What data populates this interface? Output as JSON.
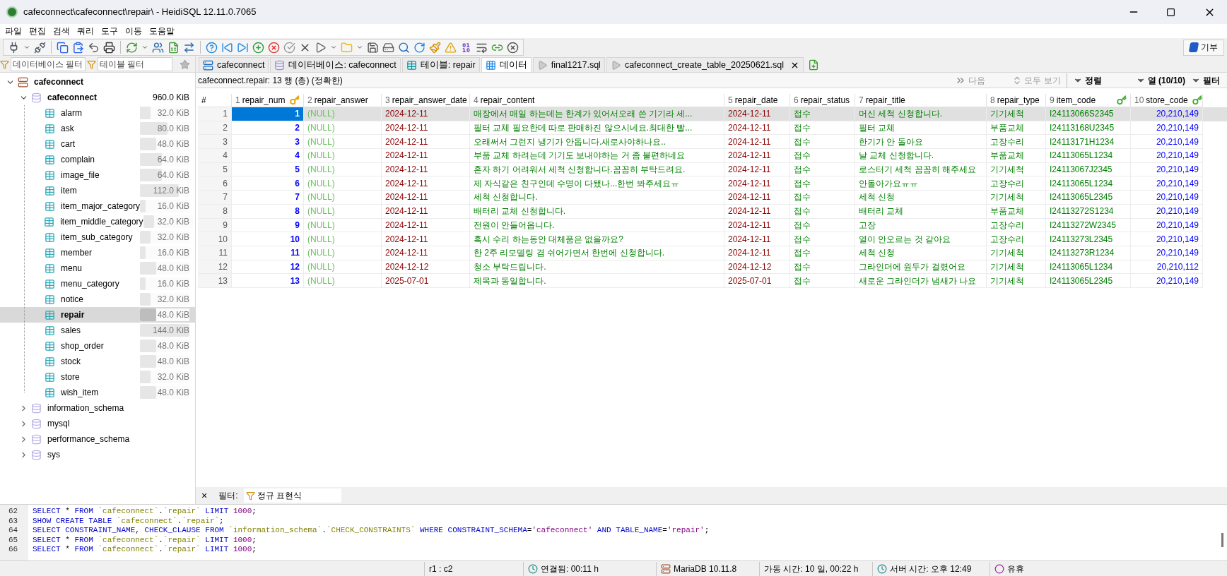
{
  "window": {
    "title": "cafeconnect\\cafeconnect\\repair\\ - HeidiSQL 12.11.0.7065"
  },
  "menu": [
    "파일",
    "편집",
    "검색",
    "쿼리",
    "도구",
    "이동",
    "도움말"
  ],
  "donate_button": "기부",
  "sidebar": {
    "filters": [
      {
        "placeholder": "데이터베이스 필터"
      },
      {
        "placeholder": "테이블 필터"
      }
    ],
    "tree": [
      {
        "label": "cafeconnect",
        "kind": "server",
        "expanded": true,
        "selected": false,
        "children": [
          {
            "label": "cafeconnect",
            "kind": "database",
            "expanded": true,
            "selected": false,
            "size": "960.0 KiB",
            "children": [
              {
                "label": "alarm",
                "kind": "table",
                "selected": false,
                "size": "32.0 KiB",
                "level": 0.22
              },
              {
                "label": "ask",
                "kind": "table",
                "selected": false,
                "size": "80.0 KiB",
                "level": 0.56
              },
              {
                "label": "cart",
                "kind": "table",
                "selected": false,
                "size": "48.0 KiB",
                "level": 0.33
              },
              {
                "label": "complain",
                "kind": "table",
                "selected": false,
                "size": "64.0 KiB",
                "level": 0.44
              },
              {
                "label": "image_file",
                "kind": "table",
                "selected": false,
                "size": "64.0 KiB",
                "level": 0.44
              },
              {
                "label": "item",
                "kind": "table",
                "selected": false,
                "size": "112.0 KiB",
                "level": 0.78
              },
              {
                "label": "item_major_category",
                "kind": "table",
                "selected": false,
                "size": "16.0 KiB",
                "level": 0.11
              },
              {
                "label": "item_middle_category",
                "kind": "table",
                "selected": false,
                "size": "32.0 KiB",
                "level": 0.22
              },
              {
                "label": "item_sub_category",
                "kind": "table",
                "selected": false,
                "size": "32.0 KiB",
                "level": 0.22
              },
              {
                "label": "member",
                "kind": "table",
                "selected": false,
                "size": "16.0 KiB",
                "level": 0.11
              },
              {
                "label": "menu",
                "kind": "table",
                "selected": false,
                "size": "48.0 KiB",
                "level": 0.33
              },
              {
                "label": "menu_category",
                "kind": "table",
                "selected": false,
                "size": "16.0 KiB",
                "level": 0.11
              },
              {
                "label": "notice",
                "kind": "table",
                "selected": false,
                "size": "32.0 KiB",
                "level": 0.22
              },
              {
                "label": "repair",
                "kind": "table",
                "selected": true,
                "size": "48.0 KiB",
                "level": 0.33
              },
              {
                "label": "sales",
                "kind": "table",
                "selected": false,
                "size": "144.0 KiB",
                "level": 1
              },
              {
                "label": "shop_order",
                "kind": "table",
                "selected": false,
                "size": "48.0 KiB",
                "level": 0.33
              },
              {
                "label": "stock",
                "kind": "table",
                "selected": false,
                "size": "48.0 KiB",
                "level": 0.33
              },
              {
                "label": "store",
                "kind": "table",
                "selected": false,
                "size": "32.0 KiB",
                "level": 0.22
              },
              {
                "label": "wish_item",
                "kind": "table",
                "selected": false,
                "size": "48.0 KiB",
                "level": 0.33
              }
            ]
          },
          {
            "label": "information_schema",
            "kind": "database",
            "expanded": false,
            "selected": false
          },
          {
            "label": "mysql",
            "kind": "database",
            "expanded": false,
            "selected": false
          },
          {
            "label": "performance_schema",
            "kind": "database",
            "expanded": false,
            "selected": false
          },
          {
            "label": "sys",
            "kind": "database",
            "expanded": false,
            "selected": false
          }
        ]
      }
    ]
  },
  "tabs": [
    {
      "label": "cafeconnect",
      "kind": "server",
      "selected": false
    },
    {
      "label": "데이터베이스: cafeconnect",
      "kind": "database",
      "selected": false
    },
    {
      "label": "테이블: repair",
      "kind": "table",
      "selected": false
    },
    {
      "label": "데이터",
      "kind": "data",
      "selected": true
    },
    {
      "label": "final1217.sql",
      "kind": "query",
      "selected": false
    },
    {
      "label": "cafeconnect_create_table_20250621.sql",
      "kind": "query",
      "selected": false,
      "closable": true
    }
  ],
  "data_bar": {
    "summary": "cafeconnect.repair: 13 행 (총) (정확한)",
    "buttons": [
      {
        "label": "다음",
        "kind": "next",
        "disabled": true
      },
      {
        "label": "모두 보기",
        "kind": "all",
        "disabled": true
      },
      {
        "label": "정렬",
        "kind": "menu",
        "disabled": false
      },
      {
        "label": "열 (10/10)",
        "kind": "menu",
        "disabled": false
      },
      {
        "label": "필터",
        "kind": "menu",
        "disabled": false
      }
    ]
  },
  "table": {
    "index_header": "#",
    "columns": [
      {
        "number": "1",
        "name": "repair_num",
        "kind": "number",
        "primary_key": true,
        "foreign_key": false
      },
      {
        "number": "2",
        "name": "repair_answer",
        "kind": "empty",
        "primary_key": false,
        "foreign_key": false
      },
      {
        "number": "3",
        "name": "repair_answer_date",
        "kind": "date",
        "primary_key": false,
        "foreign_key": false
      },
      {
        "number": "4",
        "name": "repair_content",
        "kind": "text",
        "primary_key": false,
        "foreign_key": false
      },
      {
        "number": "5",
        "name": "repair_date",
        "kind": "date",
        "primary_key": false,
        "foreign_key": false
      },
      {
        "number": "6",
        "name": "repair_status",
        "kind": "text",
        "primary_key": false,
        "foreign_key": false
      },
      {
        "number": "7",
        "name": "repair_title",
        "kind": "text",
        "primary_key": false,
        "foreign_key": false
      },
      {
        "number": "8",
        "name": "repair_type",
        "kind": "text",
        "primary_key": false,
        "foreign_key": false
      },
      {
        "number": "9",
        "name": "item_code",
        "kind": "text",
        "primary_key": false,
        "foreign_key": true
      },
      {
        "number": "10",
        "name": "store_code",
        "kind": "number",
        "primary_key": false,
        "foreign_key": true
      }
    ],
    "rows": [
      {
        "number": "1",
        "selected": true,
        "cells": [
          "1",
          "(NULL)",
          "2024-12-11",
          "매장에서 매일 하는데는 한계가 있어서오래 쓴 기기라 세...",
          "2024-12-11",
          "접수",
          "머신 세척 신청합니다.",
          "기기세척",
          "I24113066S2345",
          "20,210,149"
        ]
      },
      {
        "number": "2",
        "selected": false,
        "cells": [
          "2",
          "(NULL)",
          "2024-12-11",
          "필터 교체 필요한데 따로 판매하진 않으시네요.최대한 빨...",
          "2024-12-11",
          "접수",
          "필터 교체",
          "부품교체",
          "I24113168U2345",
          "20,210,149"
        ]
      },
      {
        "number": "3",
        "selected": false,
        "cells": [
          "3",
          "(NULL)",
          "2024-12-11",
          "오래써서 그런지 냉기가 안돕니다.새로사야하나요..",
          "2024-12-11",
          "접수",
          "한기가 안 돌아요",
          "고장수리",
          "I24113171H1234",
          "20,210,149"
        ]
      },
      {
        "number": "4",
        "selected": false,
        "cells": [
          "4",
          "(NULL)",
          "2024-12-11",
          "부품 교체 하려는데 기기도 보내야하는 거 좀 불편하네요",
          "2024-12-11",
          "접수",
          "날 교체 신청합니다.",
          "부품교체",
          "I24113065L1234",
          "20,210,149"
        ]
      },
      {
        "number": "5",
        "selected": false,
        "cells": [
          "5",
          "(NULL)",
          "2024-12-11",
          "혼자 하기 어려워서 세척 신청합니다.꼼꼼히 부탁드려요.",
          "2024-12-11",
          "접수",
          "로스터기 세척 꼼꼼히 해주세요",
          "기기세척",
          "I24113067J2345",
          "20,210,149"
        ]
      },
      {
        "number": "6",
        "selected": false,
        "cells": [
          "6",
          "(NULL)",
          "2024-12-11",
          "제 자식같은 친구인데 수명이 다됐나...한번 봐주세요ㅠ",
          "2024-12-11",
          "접수",
          "안돌아가요ㅠㅠ",
          "고장수리",
          "I24113065L1234",
          "20,210,149"
        ]
      },
      {
        "number": "7",
        "selected": false,
        "cells": [
          "7",
          "(NULL)",
          "2024-12-11",
          "세척 신청합니다.",
          "2024-12-11",
          "접수",
          "세척 신청",
          "기기세척",
          "I24113065L2345",
          "20,210,149"
        ]
      },
      {
        "number": "8",
        "selected": false,
        "cells": [
          "8",
          "(NULL)",
          "2024-12-11",
          "배터리 교체 신청합니다.",
          "2024-12-11",
          "접수",
          "배터리 교체",
          "부품교체",
          "I24113272S1234",
          "20,210,149"
        ]
      },
      {
        "number": "9",
        "selected": false,
        "cells": [
          "9",
          "(NULL)",
          "2024-12-11",
          "전원이 안들어옵니다.",
          "2024-12-11",
          "접수",
          "고장",
          "고장수리",
          "I24113272W2345",
          "20,210,149"
        ]
      },
      {
        "number": "10",
        "selected": false,
        "cells": [
          "10",
          "(NULL)",
          "2024-12-11",
          "혹시 수리 하는동안 대체품은 없을까요?",
          "2024-12-11",
          "접수",
          "열이 안오르는 것 같아요",
          "고장수리",
          "I24113273L2345",
          "20,210,149"
        ]
      },
      {
        "number": "11",
        "selected": false,
        "cells": [
          "11",
          "(NULL)",
          "2024-12-11",
          "한 2주 리모델링 겸 쉬어가면서 한번에 신청합니다.",
          "2024-12-11",
          "접수",
          "세척 신청",
          "기기세척",
          "I24113273R1234",
          "20,210,149"
        ]
      },
      {
        "number": "12",
        "selected": false,
        "cells": [
          "12",
          "(NULL)",
          "2024-12-12",
          "청소 부탁드립니다.",
          "2024-12-12",
          "접수",
          "그라인더에 원두가 걸렸어요",
          "기기세척",
          "I24113065L1234",
          "20,210,112"
        ]
      },
      {
        "number": "13",
        "selected": false,
        "cells": [
          "13",
          "(NULL)",
          "2025-07-01",
          "제목과 동일합니다.",
          "2025-07-01",
          "접수",
          "새로운 그라인더가 냄새가 나요",
          "기기세척",
          "I24113065L2345",
          "20,210,149"
        ]
      }
    ]
  },
  "filter_bar": {
    "close": "×",
    "label": "필터:",
    "regex_button": "정규 표현식"
  },
  "sql_log": [
    {
      "number": "62",
      "text": "SELECT * FROM `cafeconnect`.`repair` LIMIT 1000;"
    },
    {
      "number": "63",
      "text": "SHOW CREATE TABLE `cafeconnect`.`repair`;"
    },
    {
      "number": "64",
      "text": "SELECT CONSTRAINT_NAME, CHECK_CLAUSE FROM `information_schema`.`CHECK_CONSTRAINTS` WHERE CONSTRAINT_SCHEMA='cafeconnect' AND TABLE_NAME='repair';"
    },
    {
      "number": "65",
      "text": "SELECT * FROM `cafeconnect`.`repair` LIMIT 1000;"
    },
    {
      "number": "66",
      "text": "SELECT * FROM `cafeconnect`.`repair` LIMIT 1000;"
    }
  ],
  "status_bar": [
    {
      "kind": "position",
      "text": "r1 : c2"
    },
    {
      "kind": "clock",
      "text": "연결됨: 00:11 h"
    },
    {
      "kind": "server",
      "text": "MariaDB 10.11.8"
    },
    {
      "kind": "plain",
      "text": "가동 시간: 10 일, 00:22 h"
    },
    {
      "kind": "clock",
      "text": "서버 시간: 오후 12:49"
    },
    {
      "kind": "idle",
      "text": "유휴"
    }
  ]
}
